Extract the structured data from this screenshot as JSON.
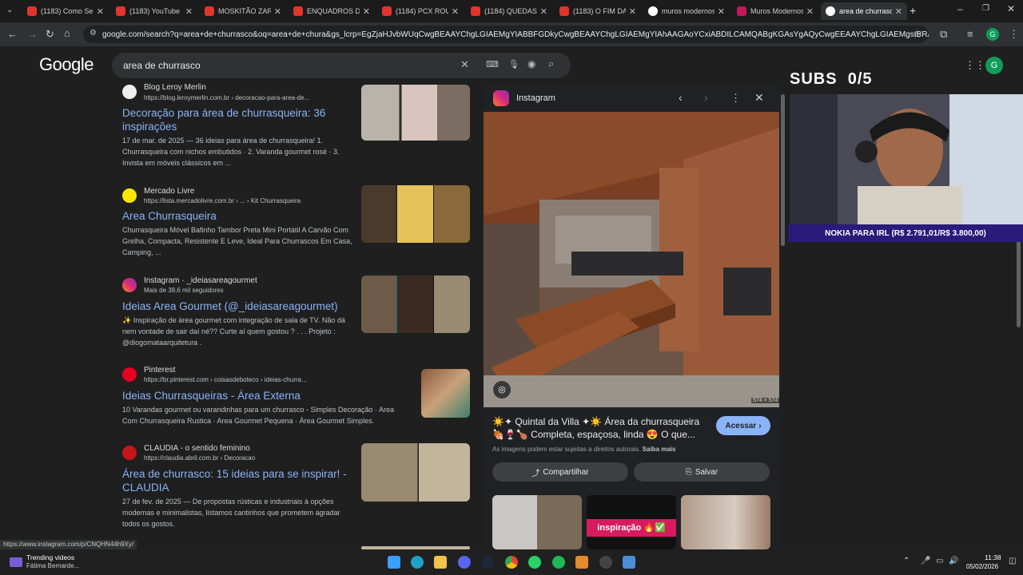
{
  "browser": {
    "tabs": [
      {
        "title": "(1183) Como Será",
        "favicon": "youtube-icon"
      },
      {
        "title": "(1183) YouTube",
        "favicon": "youtube-icon"
      },
      {
        "title": "MOSKITÃO ZARA",
        "favicon": "youtube-icon"
      },
      {
        "title": "ENQUADROS DE E",
        "favicon": "youtube-icon"
      },
      {
        "title": "(1184) PCX ROUB",
        "favicon": "youtube-icon"
      },
      {
        "title": "(1184) QUEDAS D",
        "favicon": "youtube-icon"
      },
      {
        "title": "(1183) O FIM DA",
        "favicon": "youtube-icon"
      },
      {
        "title": "muros modernos",
        "favicon": "google-icon"
      },
      {
        "title": "Muros Modernos",
        "favicon": "site-icon"
      },
      {
        "title": "area de churrasco",
        "favicon": "google-icon",
        "active": true
      }
    ],
    "url": "google.com/search?q=area+de+churrasco&oq=area+de+chura&gs_lcrp=EgZjaHJvbWUqCwgBEAAYChgLGIAEMgYIABBFGDkyCwgBEAAYChgLGIAEMgYIAhAAGAoYCxiABDILCAMQABgKGAsYgAQyCwgEEAAYChgLGIAEMgsIBRAAGAoYCxiABDILCA...",
    "avatar_letter": "G",
    "status_url": "https://www.instagram.com/p/CNQHN44h9Xy/"
  },
  "google": {
    "logo": "Google",
    "query": "area de churrasco",
    "avatar_letter": "G"
  },
  "results": [
    {
      "site": "Blog Leroy Merlin",
      "url": "https://blog.leroymerlin.com.br › decoracao-para-area-de...",
      "title": "Decoração para área de churrasqueira: 36 inspirações",
      "snippet_date": "17 de mar. de 2025 — ",
      "snippet": "36 ideias para área de churrasqueira! 1. Churrasqueira com nichos embutidos · 2. Varanda gourmet rosé · 3. Invista em móveis clássicos em ..."
    },
    {
      "site": "Mercado Livre",
      "url": "https://lista.mercadolivre.com.br › ... › Kit Churrasqueira",
      "title": "Area Churrasqueira",
      "snippet_date": "",
      "snippet": "Churrasqueira Móvel Bafinho Tambor Preta Mini Portátil A Carvão Com Grelha, Compacta, Resistente E Leve, Ideal Para Churrascos Em Casa, Camping, ..."
    },
    {
      "site": "Instagram · _ideiasareagourmet",
      "url": "Mais de 39,6 mil seguidores",
      "title": "Ideias Area Gourmet (@_ideiasareagourmet)",
      "snippet_date": "",
      "snippet": "✨ Inspiração de área gourmet com integração de sala de TV. Não dá nem vontade de sair daí né?? Curte aí quem gostou ? . . . Projeto : @diogomataarquitetura ."
    },
    {
      "site": "Pinterest",
      "url": "https://br.pinterest.com › coisasdeboteco › ideias-churra...",
      "title": "Ideias Churrasqueiras - Área Externa",
      "snippet_date": "",
      "snippet": "10 Varandas gourmet ou varandinhas para um churrasco - Simples Decoração · Area Com Churrasqueira Rustica · Area Gourmet Pequena · Área Gourmet Simples."
    },
    {
      "site": "CLAUDIA - o sentido feminino",
      "url": "https://claudia.abril.com.br › Decoracao",
      "title": "Área de churrasco: 15 ideias para se inspirar! - CLAUDIA",
      "snippet_date": "27 de fev. de 2025 — ",
      "snippet": "De propostas rústicas e industriais à opções modernas e minimalistas, listamos cantinhos que prometem agradar todos os gostos."
    }
  ],
  "panel": {
    "source": "Instagram",
    "image_size": "574 × 574",
    "caption": "☀️✦ Quintal da Villa ✦☀️ Área da churrasqueira 🍖🍷🍗 Completa, espaçosa, linda 😍 O que...",
    "visit_label": "Acessar",
    "copyright_note": "As imagens podem estar sujeitas a direitos autorais.",
    "learn_more": "Saiba mais",
    "share_label": "Compartilhar",
    "save_label": "Salvar",
    "related_badge": "inspiração 🔥✅"
  },
  "overlay": {
    "subs_label": "SUBS",
    "subs_value": "0/5",
    "goal_text": "NOKIA PARA IRL (R$ 2.791,01/R$ 3.800,00)"
  },
  "taskbar": {
    "weather_title": "Trending videos",
    "weather_sub": "Fátima Bernarde...",
    "time": "11:38",
    "date": "05/02/2026"
  },
  "colors": {
    "link": "#8ab4f8",
    "background": "#1f1f1f",
    "goal_bar": "#2a1a7a",
    "visit_button": "#8ab4f8"
  }
}
